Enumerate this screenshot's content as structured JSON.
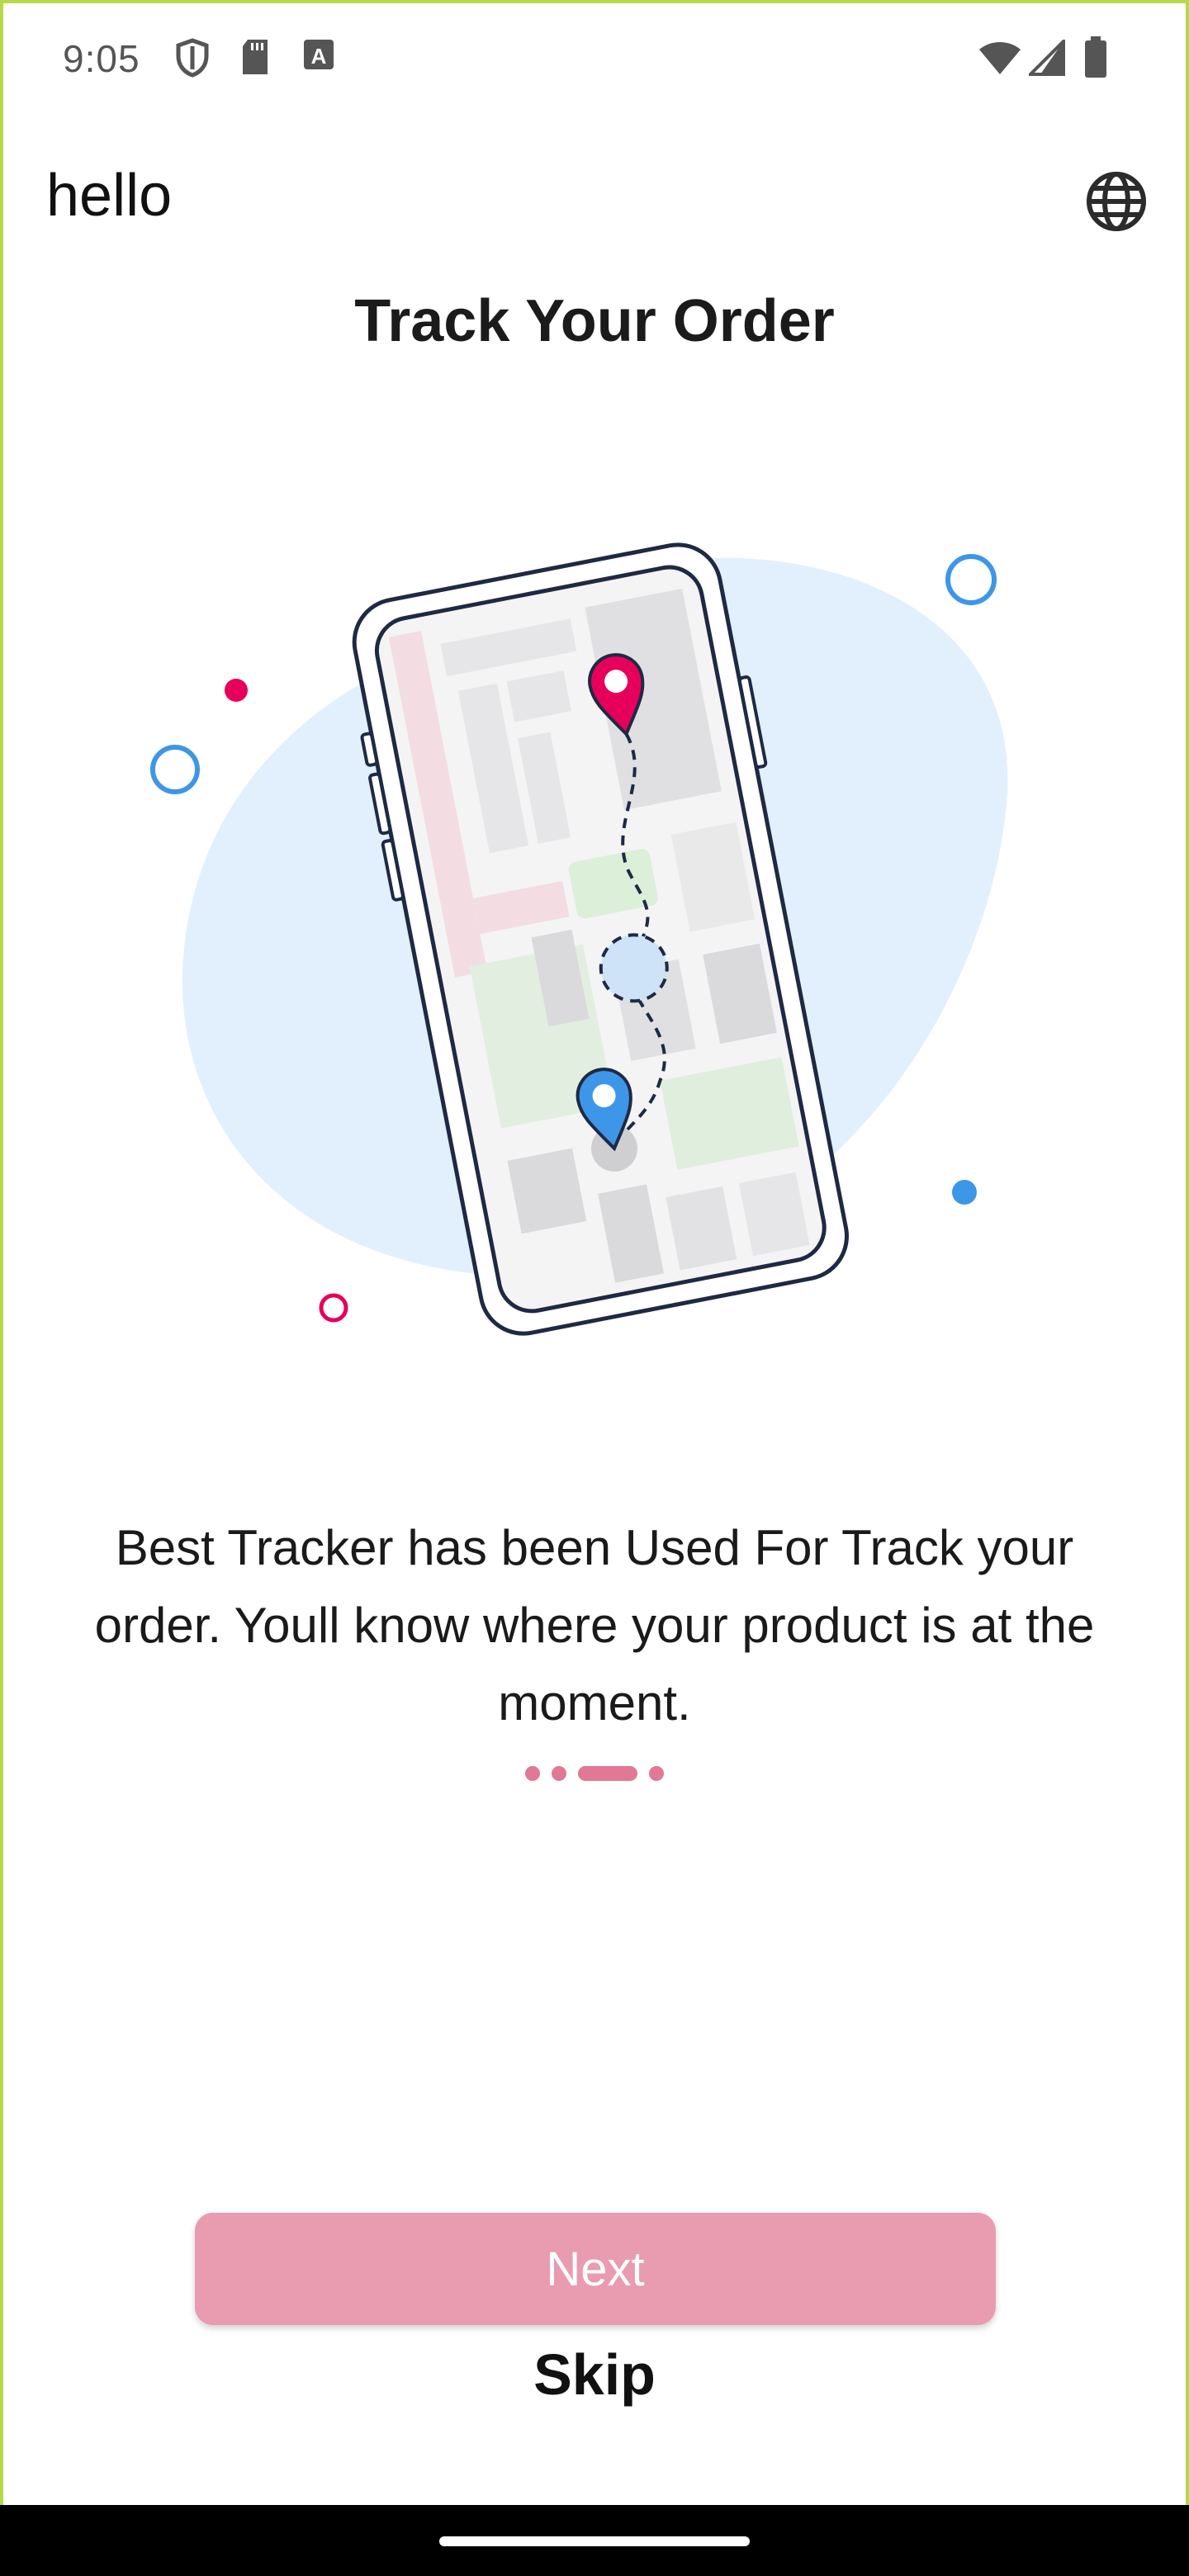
{
  "status_bar": {
    "time": "9:05",
    "left_icons": [
      "shield-icon",
      "sd-card-icon",
      "keyboard-a-icon"
    ],
    "right_icons": [
      "wifi-icon",
      "signal-icon",
      "battery-icon"
    ]
  },
  "header": {
    "app_title": "hello",
    "language_icon": "globe-icon"
  },
  "onboarding": {
    "title": "Track Your Order",
    "description": "Best Tracker has been Used For Track your order. Youll know where your product is at the moment.",
    "page_indicator": {
      "count": 4,
      "active_index": 2
    },
    "illustration": "phone-map-tracking-illustration"
  },
  "actions": {
    "next_label": "Next",
    "skip_label": "Skip"
  },
  "colors": {
    "accent": "#e99bb0",
    "pin_pink": "#e6005c",
    "pin_blue": "#3d96e8",
    "blob": "#e1f0fc",
    "frame": "#b6d94a"
  }
}
